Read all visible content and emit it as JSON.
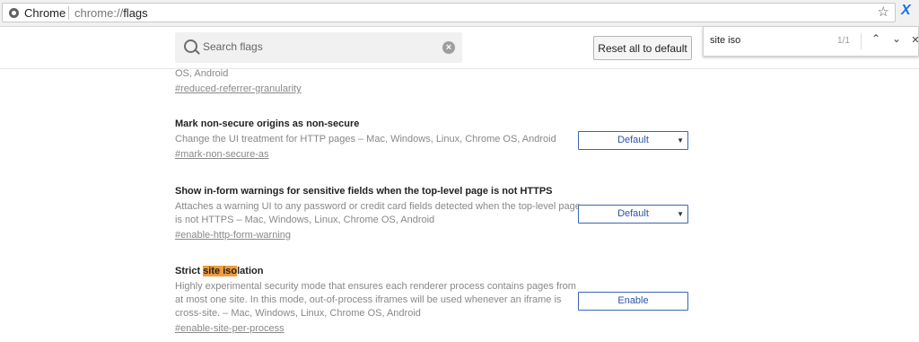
{
  "browser": {
    "chip_label": "Chrome",
    "url_scheme": "chrome://",
    "url_host": "flags",
    "star_icon": "star-icon",
    "extension_glyph": "X"
  },
  "header": {
    "search_placeholder": "Search flags",
    "reset_label": "Reset all to default"
  },
  "findbar": {
    "query": "site iso",
    "count": "1/1",
    "prev_glyph": "⌃",
    "next_glyph": "⌄",
    "close_glyph": "✕"
  },
  "flags": [
    {
      "desc_tail": "OS, Android",
      "link": "#reduced-referrer-granularity"
    },
    {
      "title": "Mark non-secure origins as non-secure",
      "desc": "Change the UI treatment for HTTP pages  – Mac, Windows, Linux, Chrome OS, Android",
      "link": "#mark-non-secure-as",
      "control": "Default"
    },
    {
      "title": "Show in-form warnings for sensitive fields when the top-level page is not HTTPS",
      "desc_line1": "Attaches a warning UI to any password or credit card fields detected when the top-level page",
      "desc_line2": "is not HTTPS  – Mac, Windows, Linux, Chrome OS, Android",
      "link": "#enable-http-form-warning",
      "control": "Default"
    },
    {
      "title_pre": "Strict ",
      "title_hl1": "site",
      "title_space": " ",
      "title_hl2": "iso",
      "title_post": "lation",
      "desc_line1": "Highly experimental security mode that ensures each renderer process contains pages from",
      "desc_line2": "at most one site. In this mode, out-of-process iframes will be used whenever an iframe is",
      "desc_line3": "cross-site.  – Mac, Windows, Linux, Chrome OS, Android",
      "link": "#enable-site-per-process",
      "control": "Enable"
    }
  ],
  "colors": {
    "accent_blue": "#3a66b5",
    "find_highlight": "#f29c3b"
  }
}
